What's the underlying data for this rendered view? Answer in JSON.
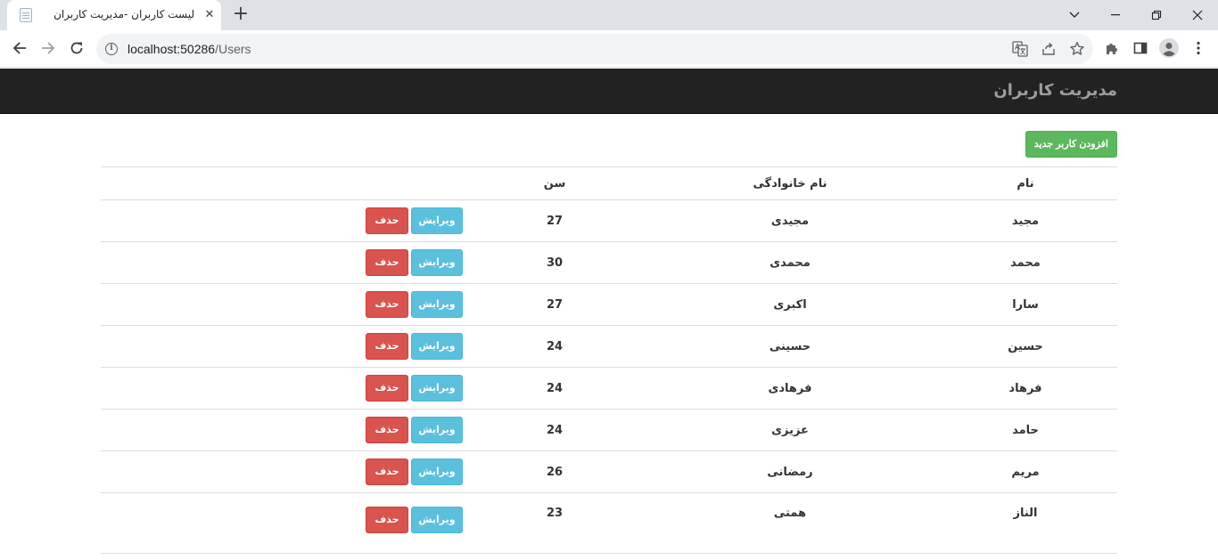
{
  "browser": {
    "tab_title": "لیست کاربران -مدیریت کاربران",
    "tab_close": "✕",
    "new_tab": "+",
    "url_host": "localhost:50286",
    "url_path": "/Users"
  },
  "navbar": {
    "brand": "مدیریت کاربران"
  },
  "actions": {
    "add_user_label": "افزودن کاربر جدید"
  },
  "table": {
    "headers": {
      "name": "نام",
      "family": "نام خانوادگی",
      "age": "سن",
      "actions": ""
    },
    "edit_label": "ویرایش",
    "delete_label": "حذف",
    "rows": [
      {
        "name": "مجید",
        "family": "مجیدی",
        "age": "27"
      },
      {
        "name": "محمد",
        "family": "محمدی",
        "age": "30"
      },
      {
        "name": "سارا",
        "family": "اکبری",
        "age": "27"
      },
      {
        "name": "حسین",
        "family": "حسینی",
        "age": "24"
      },
      {
        "name": "فرهاد",
        "family": "فرهادی",
        "age": "24"
      },
      {
        "name": "حامد",
        "family": "عزیزی",
        "age": "24"
      },
      {
        "name": "مریم",
        "family": "رمضانی",
        "age": "26"
      },
      {
        "name": "الناز",
        "family": "همتی",
        "age": "23"
      }
    ]
  },
  "colors": {
    "navbar_bg": "#222222",
    "add_button": "#5cb85c",
    "edit_button": "#5bc0de",
    "delete_button": "#d9534f"
  }
}
